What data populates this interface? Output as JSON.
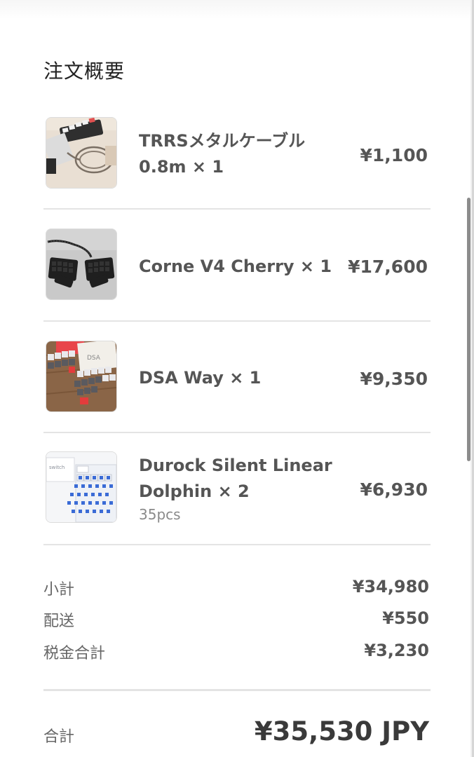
{
  "order_summary": {
    "title": "注文概要",
    "items": [
      {
        "name": "TRRSメタルケーブル 0.8m × 1",
        "price": "¥1,100",
        "image": "cable-photo"
      },
      {
        "name": "Corne V4 Cherry × 1",
        "price": "¥17,600",
        "image": "keyboard-photo"
      },
      {
        "name": "DSA Way × 1",
        "price": "¥9,350",
        "image": "keycaps-photo"
      },
      {
        "name": "Durock Silent Linear Dolphin × 2",
        "variant": "35pcs",
        "price": "¥6,930",
        "image": "switches-photo"
      }
    ],
    "subtotal": {
      "label": "小計",
      "value": "¥34,980"
    },
    "shipping": {
      "label": "配送",
      "value": "¥550"
    },
    "tax": {
      "label": "税金合計",
      "value": "¥3,230"
    },
    "total": {
      "label": "合計",
      "value": "¥35,530 JPY"
    }
  }
}
